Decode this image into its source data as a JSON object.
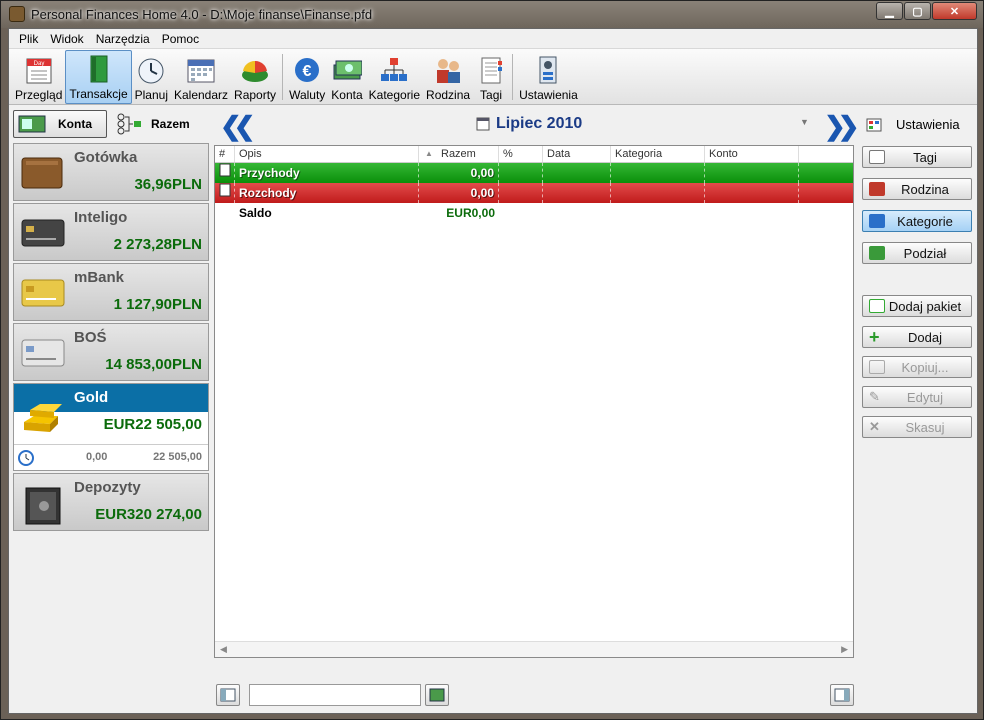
{
  "window": {
    "title": "Personal Finances Home 4.0 - D:\\Moje finanse\\Finanse.pfd"
  },
  "menu": [
    "Plik",
    "Widok",
    "Narzędzia",
    "Pomoc"
  ],
  "toolbar": {
    "items": [
      {
        "label": "Przegląd",
        "icon": "calendar-day-icon"
      },
      {
        "label": "Transakcje",
        "icon": "book-icon",
        "active": true
      },
      {
        "label": "Planuj",
        "icon": "clock-icon"
      },
      {
        "label": "Kalendarz",
        "icon": "calendar-icon"
      },
      {
        "label": "Raporty",
        "icon": "pie-chart-icon"
      },
      {
        "label": "Waluty",
        "icon": "currency-icon"
      },
      {
        "label": "Konta",
        "icon": "money-icon"
      },
      {
        "label": "Kategorie",
        "icon": "hierarchy-icon"
      },
      {
        "label": "Rodzina",
        "icon": "family-icon"
      },
      {
        "label": "Tagi",
        "icon": "tags-icon"
      },
      {
        "label": "Ustawienia",
        "icon": "settings-icon"
      }
    ]
  },
  "left": {
    "konta_label": "Konta",
    "razem_label": "Razem",
    "accounts": [
      {
        "name": "Gotówka",
        "value": "36,96PLN",
        "icon": "wallet-icon"
      },
      {
        "name": "Inteligo",
        "value": "2 273,28PLN",
        "icon": "credit-card-icon"
      },
      {
        "name": "mBank",
        "value": "1 127,90PLN",
        "icon": "credit-card-icon"
      },
      {
        "name": "BOŚ",
        "value": "14 853,00PLN",
        "icon": "credit-card-icon"
      },
      {
        "name": "Gold",
        "value": "EUR22 505,00",
        "icon": "gold-bars-icon",
        "selected": true,
        "sub_left": "0,00",
        "sub_right": "22 505,00"
      },
      {
        "name": "Depozyty",
        "value": "EUR320 274,00",
        "icon": "safe-icon"
      }
    ]
  },
  "center": {
    "month": "Lipiec 2010",
    "columns": [
      "#",
      "Opis",
      "Razem",
      "%",
      "Data",
      "Kategoria",
      "Konto"
    ],
    "rows": [
      {
        "desc": "Przychody",
        "amount": "0,00",
        "kind": "income"
      },
      {
        "desc": "Rozchody",
        "amount": "0,00",
        "kind": "expense"
      },
      {
        "desc": "Saldo",
        "amount": "EUR0,00",
        "kind": "balance"
      }
    ]
  },
  "right": {
    "settings_label": "Ustawienia",
    "buttons": [
      {
        "label": "Tagi",
        "icon": "tags-icon"
      },
      {
        "label": "Rodzina",
        "icon": "family-icon"
      },
      {
        "label": "Kategorie",
        "icon": "hierarchy-icon",
        "active": true
      },
      {
        "label": "Podział",
        "icon": "split-icon"
      },
      {
        "label": "Dodaj pakiet",
        "icon": "add-package-icon"
      },
      {
        "label": "Dodaj",
        "icon": "plus-icon"
      },
      {
        "label": "Kopiuj...",
        "icon": "copy-icon",
        "disabled": true
      },
      {
        "label": "Edytuj",
        "icon": "pencil-icon",
        "disabled": true
      },
      {
        "label": "Skasuj",
        "icon": "delete-icon",
        "disabled": true
      }
    ]
  },
  "colors": {
    "income": "#16a016",
    "expense": "#d02828",
    "selected": "#0b6fa6",
    "value_green": "#0b6b0b"
  }
}
